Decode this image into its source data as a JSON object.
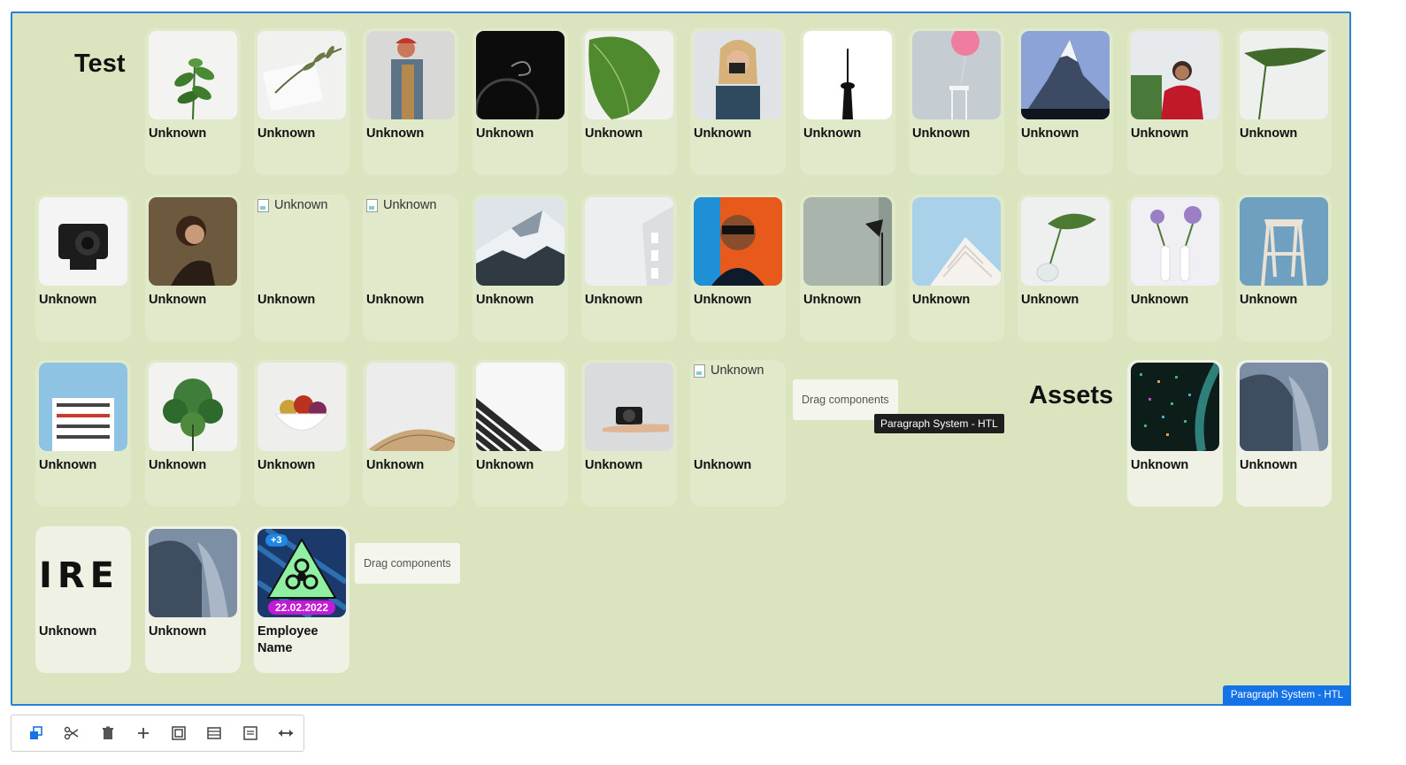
{
  "headings": {
    "test": "Test",
    "assets": "Assets"
  },
  "row1": [
    "Unknown",
    "Unknown",
    "Unknown",
    "Unknown",
    "Unknown",
    "Unknown",
    "Unknown",
    "Unknown",
    "Unknown",
    "Unknown",
    "Unknown"
  ],
  "row2": [
    "Unknown",
    "Unknown",
    "Unknown",
    "Unknown",
    "Unknown",
    "Unknown",
    "Unknown",
    "Unknown",
    "Unknown",
    "Unknown",
    "Unknown",
    "Unknown"
  ],
  "row3": [
    "Unknown",
    "Unknown",
    "Unknown",
    "Unknown",
    "Unknown",
    "Unknown",
    "Unknown"
  ],
  "assets": [
    "Unknown",
    "Unknown"
  ],
  "row4": [
    "Unknown",
    "Unknown"
  ],
  "broken_alt": "Unknown",
  "tire_text": "IRE",
  "employee": {
    "name": "Employee Name",
    "count_badge": "+3",
    "date_badge": "22.02.2022"
  },
  "drag_placeholder": "Drag components",
  "tooltip": "Paragraph System - HTL",
  "paragraph_system_badge": "Paragraph System - HTL",
  "toolbar": [
    "copy-icon",
    "cut-icon",
    "delete-icon",
    "add-icon",
    "group-icon",
    "layout-icon",
    "paragraph-icon",
    "resize-icon"
  ],
  "colors": {
    "canvas": "#dae4bf",
    "frame_border": "#2a80d6",
    "accent": "#1473e6",
    "date_badge": "#c21ad6"
  }
}
